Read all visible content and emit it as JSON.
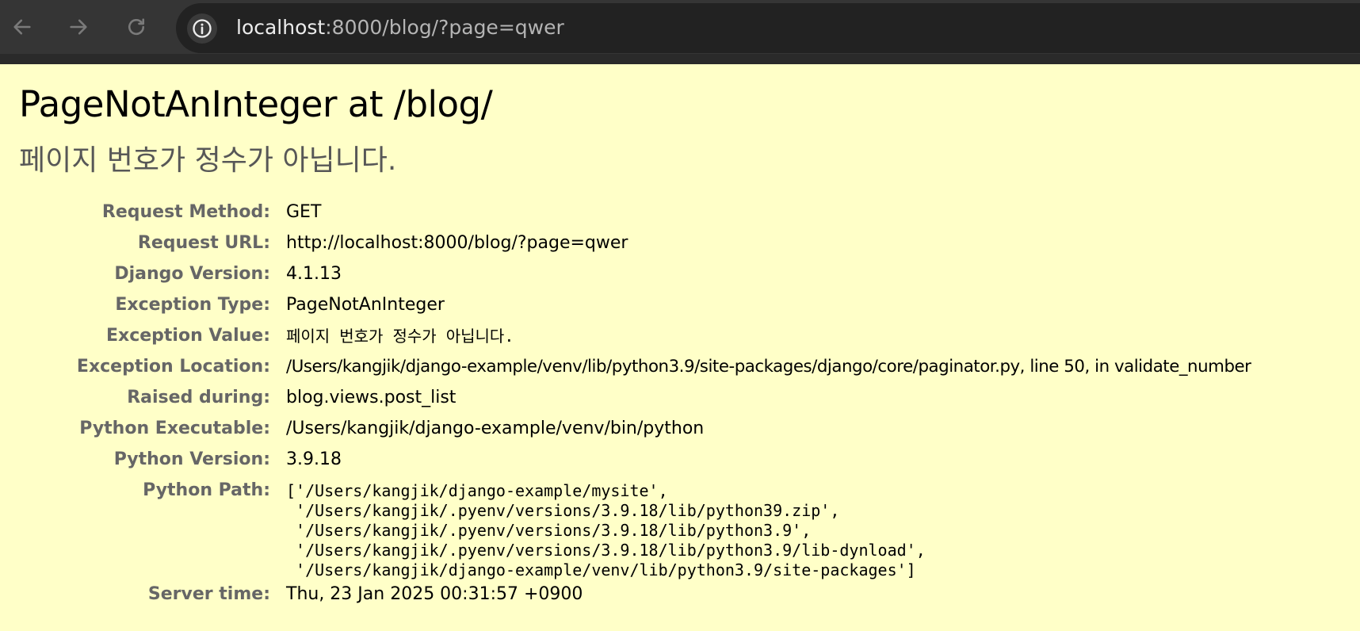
{
  "browser": {
    "url_host": "localhost",
    "url_rest": ":8000/blog/?page=qwer",
    "icons": {
      "back": "arrow-left-icon",
      "forward": "arrow-right-icon",
      "reload": "reload-icon",
      "site_info": "info-circle-icon"
    }
  },
  "page": {
    "title": "PageNotAnInteger at /blog/",
    "subtitle": "페이지 번호가 정수가 아닙니다.",
    "meta": [
      {
        "label": "Request Method:",
        "value": "GET"
      },
      {
        "label": "Request URL:",
        "value": "http://localhost:8000/blog/?page=qwer"
      },
      {
        "label": "Django Version:",
        "value": "4.1.13"
      },
      {
        "label": "Exception Type:",
        "value": "PageNotAnInteger"
      },
      {
        "label": "Exception Value:",
        "value": "페이지 번호가 정수가 아닙니다."
      },
      {
        "label": "Exception Location:",
        "value": "/Users/kangjik/django-example/venv/lib/python3.9/site-packages/django/core/paginator.py, line 50, in validate_number"
      },
      {
        "label": "Raised during:",
        "value": "blog.views.post_list"
      },
      {
        "label": "Python Executable:",
        "value": "/Users/kangjik/django-example/venv/bin/python"
      },
      {
        "label": "Python Version:",
        "value": "3.9.18"
      },
      {
        "label": "Python Path:",
        "value": "['/Users/kangjik/django-example/mysite',\n '/Users/kangjik/.pyenv/versions/3.9.18/lib/python39.zip',\n '/Users/kangjik/.pyenv/versions/3.9.18/lib/python3.9',\n '/Users/kangjik/.pyenv/versions/3.9.18/lib/python3.9/lib-dynload',\n '/Users/kangjik/django-example/venv/lib/python3.9/site-packages']"
      },
      {
        "label": "Server time:",
        "value": "Thu, 23 Jan 2025 00:31:57 +0900"
      }
    ]
  },
  "colors": {
    "page_background": "#ffffc8",
    "toolbar_background": "#353535",
    "label_color": "#666666",
    "subtitle_color": "#575757"
  }
}
